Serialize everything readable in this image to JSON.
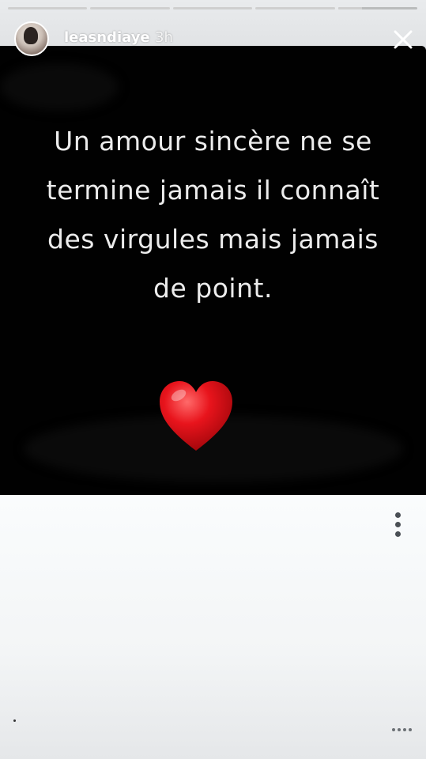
{
  "story": {
    "progress": [
      1,
      1,
      1,
      1,
      0.3
    ],
    "user": {
      "username": "leasndiaye",
      "time_ago": "3h"
    },
    "quote_text": "Un amour sincère ne se\ntermine jamais il connaît\ndes virgules mais jamais\nde point.",
    "emoji": "heart-emoji",
    "icons": {
      "close": "close-icon",
      "more": "more-vertical-icon"
    },
    "colors": {
      "card_background": "#010101",
      "quote_text": "#ececec",
      "heart": "#e3131b",
      "lower_background": "#f4f6f8"
    }
  }
}
